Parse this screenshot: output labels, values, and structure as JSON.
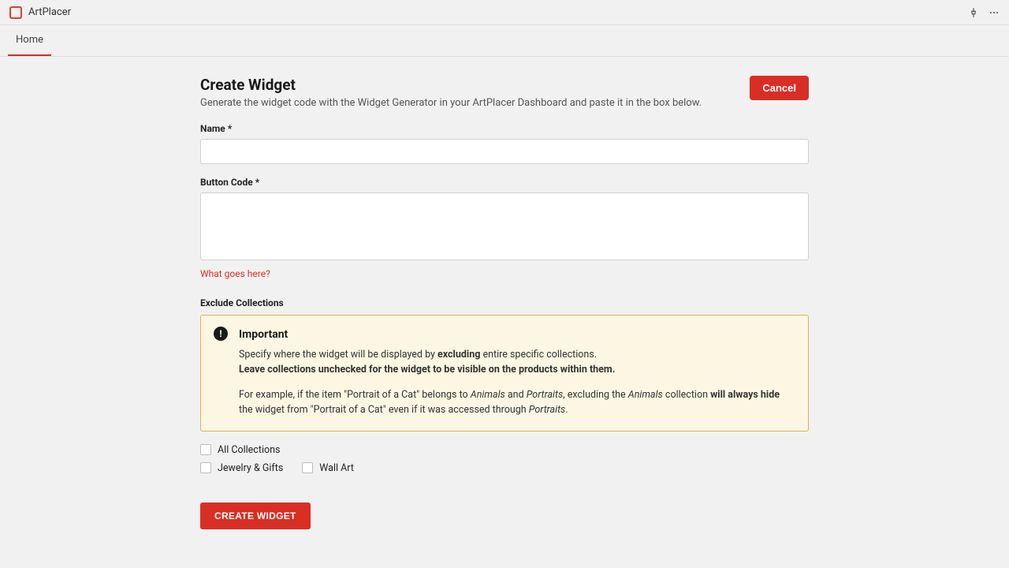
{
  "app": {
    "name": "ArtPlacer"
  },
  "tabs": {
    "home": "Home"
  },
  "header": {
    "title": "Create Widget",
    "subtitle": "Generate the widget code with the Widget Generator in your ArtPlacer Dashboard and paste it in the box below.",
    "cancel_label": "Cancel"
  },
  "form": {
    "name_label": "Name *",
    "name_value": "",
    "code_label": "Button Code *",
    "code_value": "",
    "help_link": "What goes here?",
    "exclude_label": "Exclude Collections",
    "submit_label": "CREATE WIDGET"
  },
  "alert": {
    "title": "Important",
    "line1_a": "Specify where the widget will be displayed by ",
    "line1_b": "excluding",
    "line1_c": " entire specific collections.",
    "line2": "Leave collections unchecked for the widget to be visible on the products within them.",
    "line3_a": "For example, if the item \"Portrait of a Cat\" belongs to ",
    "line3_b": "Animals",
    "line3_c": " and ",
    "line3_d": "Portraits",
    "line3_e": ", excluding the ",
    "line3_f": "Animals",
    "line3_g": " collection ",
    "line3_h": "will always hide",
    "line3_i": " the widget from \"Portrait of a Cat\" even if it was accessed through ",
    "line3_j": "Portraits",
    "line3_k": "."
  },
  "collections": {
    "all": "All Collections",
    "jewelry": "Jewelry & Gifts",
    "wallart": "Wall Art"
  }
}
